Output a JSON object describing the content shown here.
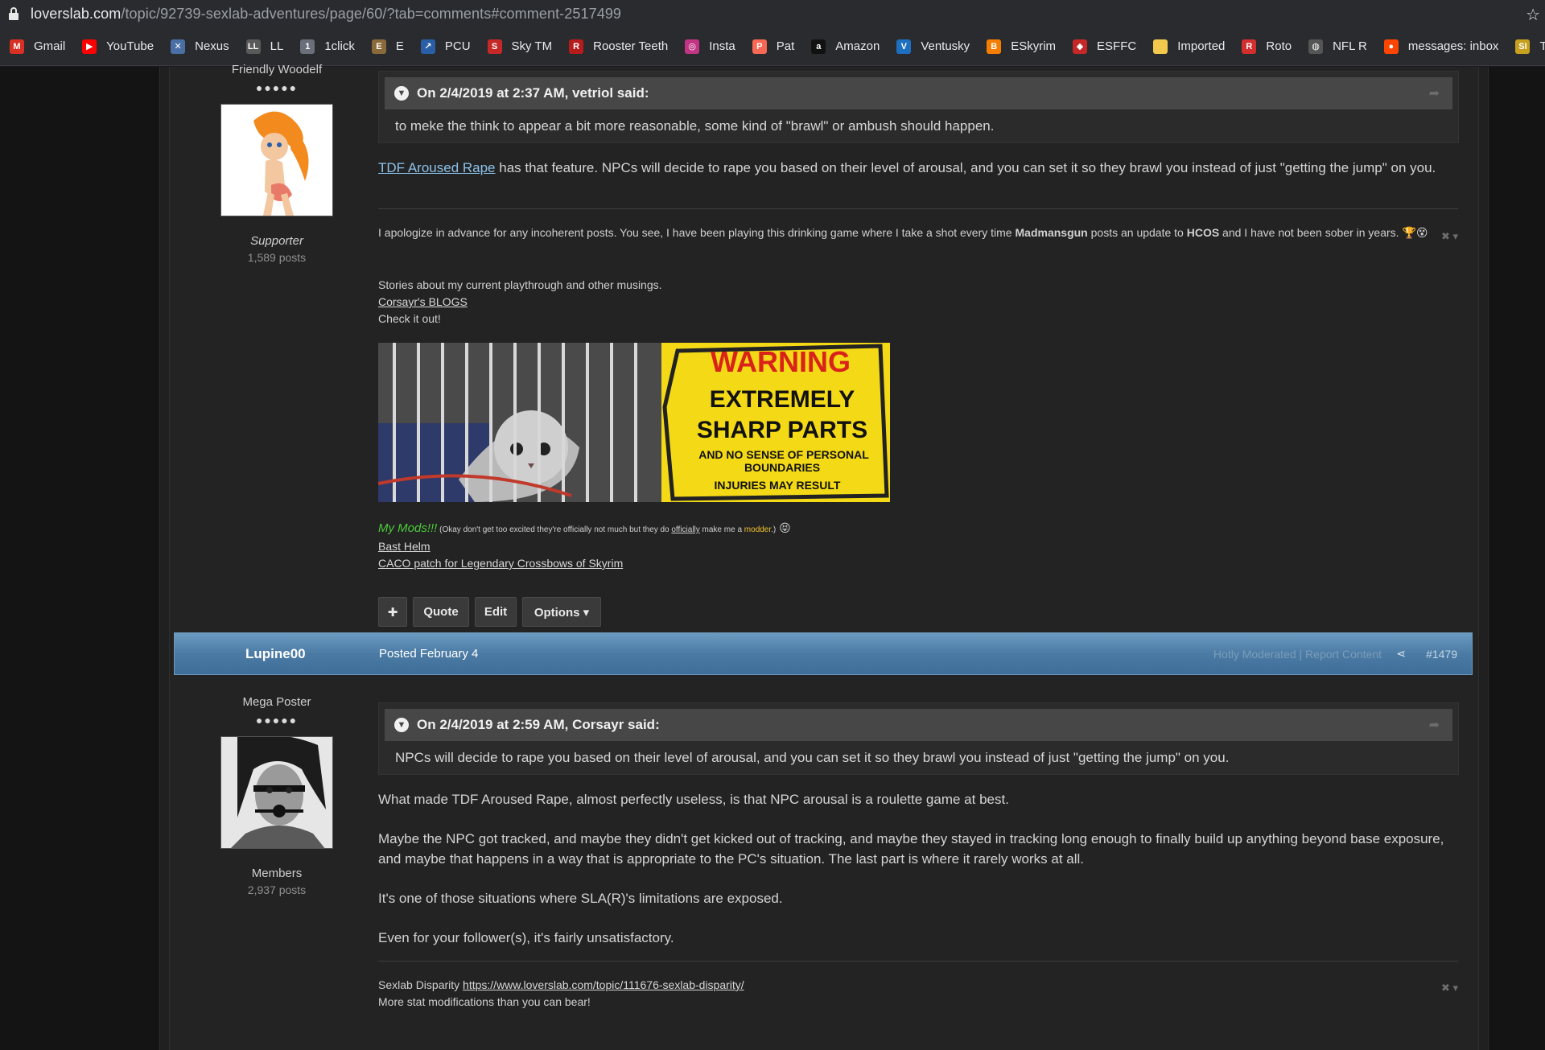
{
  "browser": {
    "url_domain": "loverslab.com",
    "url_path": "/topic/92739-sexlab-adventures/page/60/?tab=comments#comment-2517499",
    "bookmarks": [
      {
        "label": "Gmail",
        "icon": "gmail-icon",
        "color": "#d93025",
        "glyph": "M"
      },
      {
        "label": "YouTube",
        "icon": "youtube-icon",
        "color": "#ff0000",
        "glyph": "▶"
      },
      {
        "label": "Nexus",
        "icon": "nexus-icon",
        "color": "#4a6fa5",
        "glyph": "✕"
      },
      {
        "label": "LL",
        "icon": "ll-icon",
        "color": "#5a5a5a",
        "glyph": "LL"
      },
      {
        "label": "1click",
        "icon": "1click-icon",
        "color": "#6a6f7a",
        "glyph": "1"
      },
      {
        "label": "E",
        "icon": "e-icon",
        "color": "#8a6a3a",
        "glyph": "E"
      },
      {
        "label": "PCU",
        "icon": "pcu-icon",
        "color": "#2a5fa8",
        "glyph": "↗"
      },
      {
        "label": "Sky TM",
        "icon": "sky-tm-icon",
        "color": "#c62828",
        "glyph": "S"
      },
      {
        "label": "Rooster Teeth",
        "icon": "rooster-teeth-icon",
        "color": "#b71c1c",
        "glyph": "R"
      },
      {
        "label": "Insta",
        "icon": "instagram-icon",
        "color": "#c13584",
        "glyph": "◎"
      },
      {
        "label": "Pat",
        "icon": "patreon-icon",
        "color": "#f96854",
        "glyph": "P"
      },
      {
        "label": "Amazon",
        "icon": "amazon-icon",
        "color": "#111111",
        "glyph": "a"
      },
      {
        "label": "Ventusky",
        "icon": "ventusky-icon",
        "color": "#1e6fbf",
        "glyph": "V"
      },
      {
        "label": "ESkyrim",
        "icon": "blogger-icon",
        "color": "#f57d00",
        "glyph": "B"
      },
      {
        "label": "ESFFC",
        "icon": "esffc-icon",
        "color": "#c62828",
        "glyph": "◆"
      },
      {
        "label": "Imported",
        "icon": "folder-icon",
        "color": "#f2c94c",
        "glyph": ""
      },
      {
        "label": "Roto",
        "icon": "roto-icon",
        "color": "#d32f2f",
        "glyph": "R"
      },
      {
        "label": "NFL R",
        "icon": "globe-icon",
        "color": "#555555",
        "glyph": "◍"
      },
      {
        "label": "messages: inbox",
        "icon": "reddit-icon",
        "color": "#ff4500",
        "glyph": "●"
      },
      {
        "label": "TSD",
        "icon": "tsd-icon",
        "color": "#c8a020",
        "glyph": "SI"
      }
    ]
  },
  "post1": {
    "author_rank": "Friendly Woodelf",
    "pips": "●●●●●",
    "group": "Supporter",
    "post_count": "1,589 posts",
    "quote_header": "On 2/4/2019 at 2:37 AM, vetriol said:",
    "quote_text": "to meke the think to appear a bit more reasonable, some kind of \"brawl\" or ambush should happen.",
    "body_link": "TDF Aroused Rape",
    "body_text": " has that feature. NPCs will decide to rape you based on their level of arousal, and you can set it so they brawl you instead of just \"getting the jump\" on you.",
    "sig": {
      "line1_a": "I apologize in advance for any incoherent posts. You see, I have been playing this drinking game where I take a shot every time ",
      "line1_b": "Madmansgun",
      "line1_c": " posts an update to ",
      "line1_d": "HCOS",
      "line1_e": " and I have not been sober in years. ",
      "emojis": "🏆😵",
      "stories": "Stories about my current playthrough and other musings.",
      "blogs_link": "Corsayr's BLOGS",
      "check": "Check it out!",
      "sign_warning": "WARNING",
      "sign_line2": "EXTREMELY",
      "sign_line3": "SHARP PARTS",
      "sign_line4": "AND NO SENSE OF PERSONAL",
      "sign_line5": "BOUNDARIES",
      "sign_line6": "INJURIES MAY RESULT",
      "mods_title": "My Mods!!!",
      "mods_note_a": " (Okay don't get too excited they're officially not much but they do ",
      "mods_note_b": "officially",
      "mods_note_c": " make me a ",
      "mods_note_d": "modder",
      "mods_note_e": ".)",
      "mods_emoji": "😝",
      "mod1": "Bast Helm",
      "mod2": "CACO patch for Legendary Crossbows of Skyrim",
      "ctrl": "✖ ▾"
    },
    "buttons": {
      "plus": "✚",
      "quote": "Quote",
      "edit": "Edit",
      "options": "Options ▾"
    }
  },
  "post2": {
    "username": "Lupine00",
    "posted": "Posted February 4",
    "faint_actions": "Hotly Moderated | Report Content",
    "share_icon": "⋖",
    "post_number": "#1479",
    "author_rank": "Mega Poster",
    "pips": "●●●●●",
    "group": "Members",
    "post_count": "2,937 posts",
    "quote_header": "On 2/4/2019 at 2:59 AM, Corsayr said:",
    "quote_text": "NPCs will decide to rape you based on their level of arousal, and you can set it so they brawl you instead of just \"getting the jump\" on you.",
    "para1": "What made TDF Aroused Rape, almost perfectly useless, is that NPC arousal is a roulette game at best.",
    "para2": "Maybe the NPC got tracked, and maybe they didn't get kicked out of tracking, and maybe they stayed in tracking long enough to finally build up anything beyond base exposure, and maybe that happens in a way that is appropriate to the PC's situation. The last part is where it rarely works at all.",
    "para3": "It's one of those situations where SLA(R)'s limitations are exposed.",
    "para4": "Even for your follower(s), it's fairly unsatisfactory.",
    "sig_label": "Sexlab Disparity ",
    "sig_link": "https://www.loverslab.com/topic/111676-sexlab-disparity/",
    "sig_line2": "More stat modifications than you can bear!",
    "ctrl": "✖ ▾"
  }
}
